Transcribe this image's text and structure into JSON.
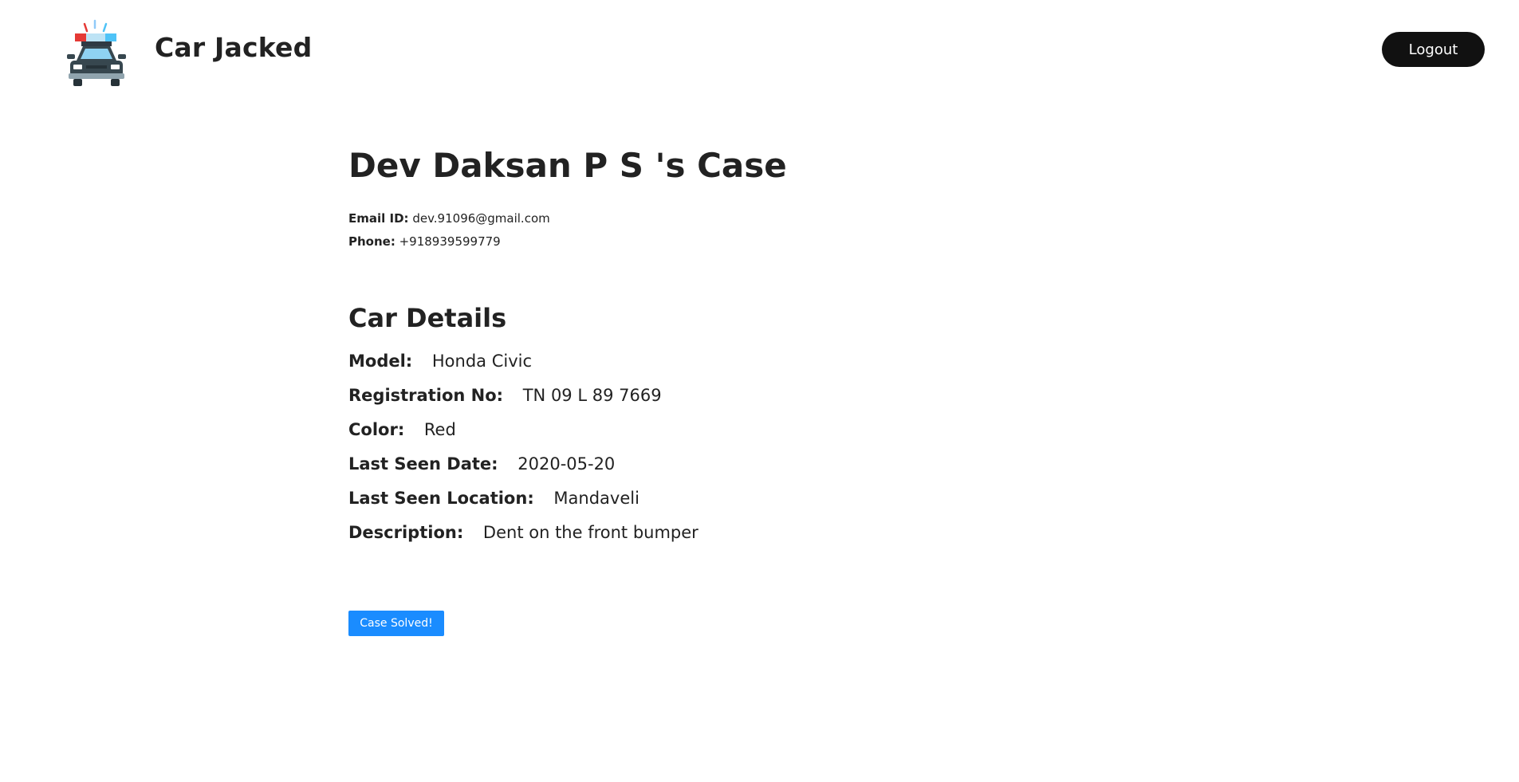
{
  "header": {
    "brand": "Car Jacked",
    "logo_icon": "police-car-icon",
    "logout_label": "Logout"
  },
  "case": {
    "title": "Dev Daksan P S 's Case",
    "email_label": "Email ID:",
    "email": "dev.91096@gmail.com",
    "phone_label": "Phone:",
    "phone": "+918939599779"
  },
  "car_details": {
    "title": "Car Details",
    "fields": [
      {
        "label": "Model:",
        "value": "Honda Civic"
      },
      {
        "label": "Registration No:",
        "value": "TN 09 L 89 7669"
      },
      {
        "label": "Color:",
        "value": "Red"
      },
      {
        "label": "Last Seen Date:",
        "value": "2020-05-20"
      },
      {
        "label": "Last Seen Location:",
        "value": "Mandaveli"
      },
      {
        "label": "Description:",
        "value": "Dent on the front bumper"
      }
    ]
  },
  "actions": {
    "solve_label": "Case Solved!"
  },
  "colors": {
    "primary_button": "#1a8cff",
    "logout_button": "#111111",
    "text": "#222222"
  }
}
